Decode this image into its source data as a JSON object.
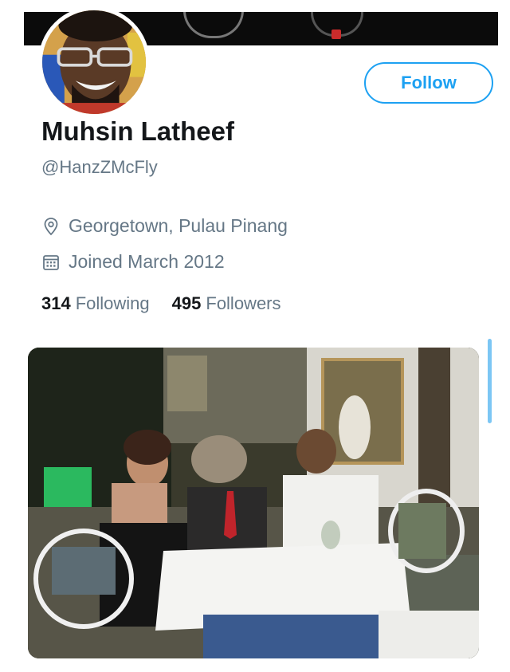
{
  "profile": {
    "name": "Muhsin Latheef",
    "handle": "@HanzZMcFly",
    "location": "Georgetown, Pulau Pinang",
    "joined": "Joined March 2012",
    "following_count": "314",
    "following_label": "Following",
    "followers_count": "495",
    "followers_label": "Followers"
  },
  "actions": {
    "follow_label": "Follow"
  },
  "icons": {
    "location": "location-pin-icon",
    "joined": "calendar-icon"
  },
  "colors": {
    "accent": "#1da1f2",
    "secondary_text": "#657786",
    "primary_text": "#14171a"
  }
}
